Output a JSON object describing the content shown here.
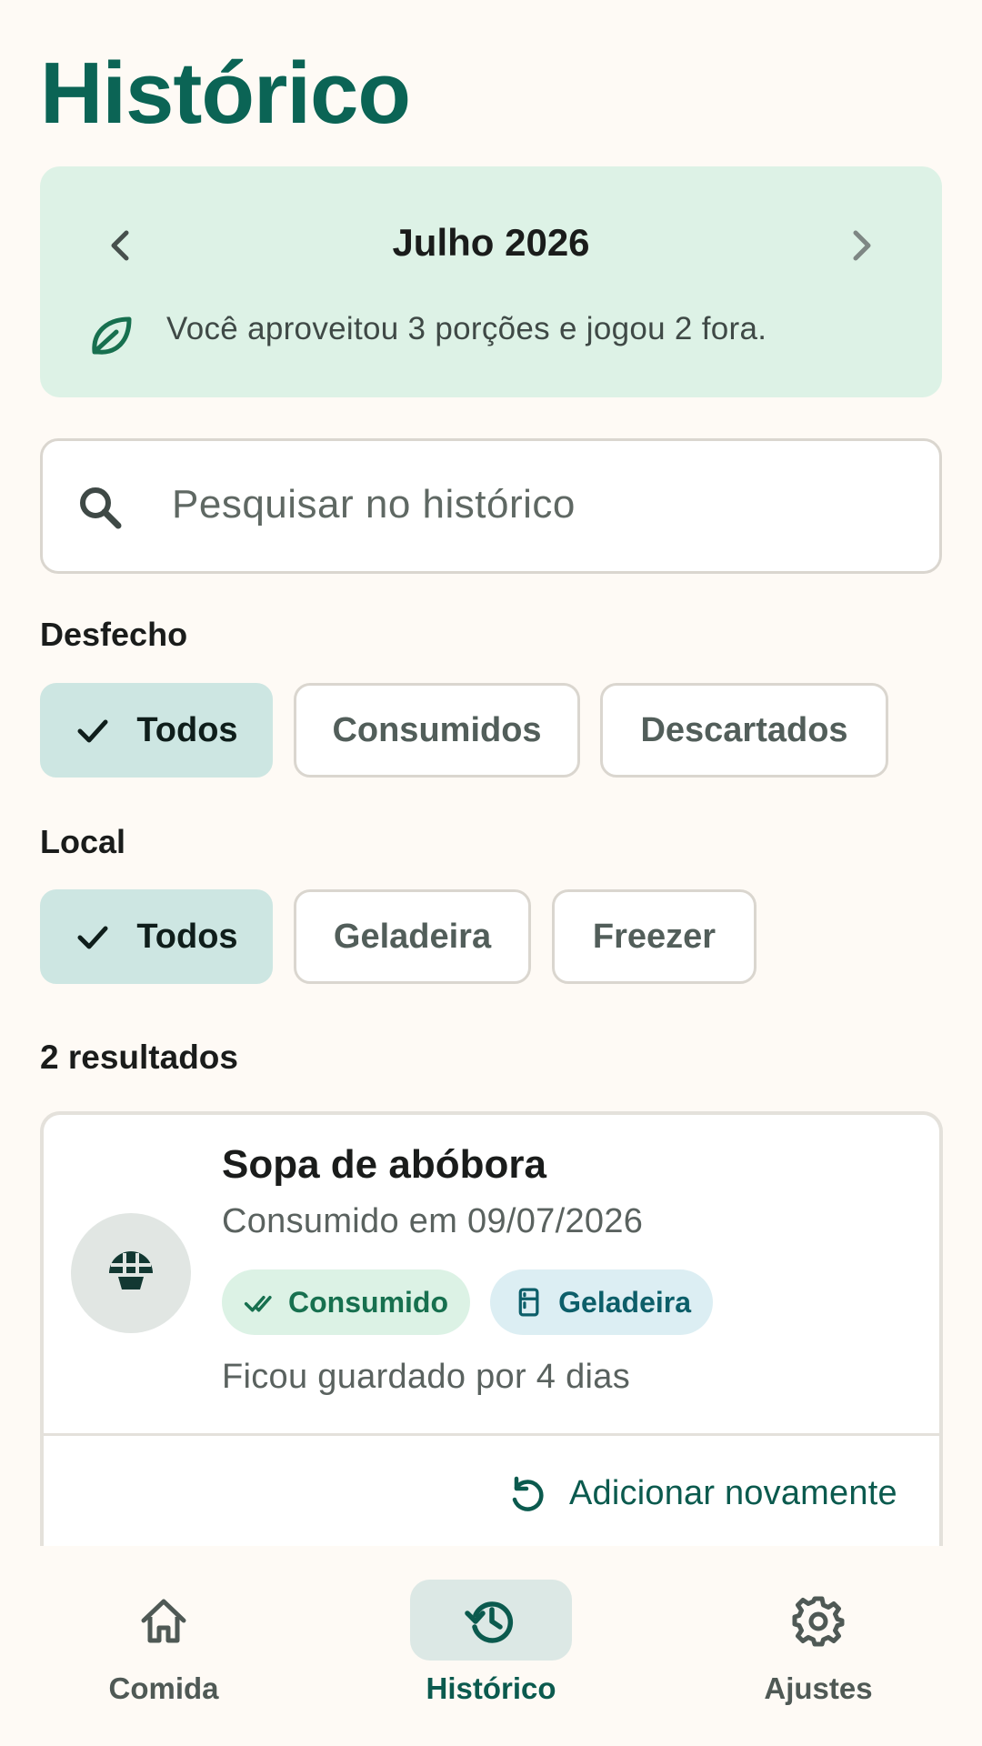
{
  "page": {
    "title": "Histórico"
  },
  "month": {
    "label": "Julho 2026",
    "summary": "Você aproveitou 3 porções e jogou 2 fora."
  },
  "search": {
    "placeholder": "Pesquisar no histórico"
  },
  "filters": {
    "outcome": {
      "label": "Desfecho",
      "options": [
        "Todos",
        "Consumidos",
        "Descartados"
      ],
      "selected": "Todos"
    },
    "location": {
      "label": "Local",
      "options": [
        "Todos",
        "Geladeira",
        "Freezer"
      ],
      "selected": "Todos"
    }
  },
  "results": {
    "count_label": "2 resultados",
    "items": [
      {
        "name": "Sopa de abóbora",
        "date_text": "Consumido em 09/07/2026",
        "status_badge": "Consumido",
        "location_badge": "Geladeira",
        "stored_text": "Ficou guardado por 4 dias",
        "action_label": "Adicionar novamente"
      }
    ]
  },
  "nav": {
    "items": [
      {
        "label": "Comida",
        "icon": "home-icon"
      },
      {
        "label": "Histórico",
        "icon": "history-icon",
        "active": true
      },
      {
        "label": "Ajustes",
        "icon": "gear-icon"
      }
    ]
  },
  "colors": {
    "accent": "#0B6455",
    "background": "#FEFAF5",
    "month_card": "#DDF2E6",
    "chip_selected": "#CDE6E2"
  }
}
